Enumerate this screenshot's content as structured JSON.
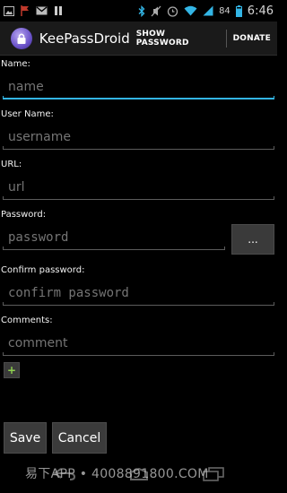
{
  "status_bar": {
    "time": "6:46",
    "battery": "84",
    "icons": [
      "image-icon",
      "flag-icon",
      "gmail-icon",
      "pause-icon",
      "bluetooth-icon",
      "mute-icon",
      "alarm-icon",
      "wifi-icon",
      "signal-icon",
      "battery-icon"
    ]
  },
  "action_bar": {
    "title": "KeePassDroid",
    "show_password": "SHOW PASSWORD",
    "donate": "DONATE"
  },
  "form": {
    "name_label": "Name:",
    "name_placeholder": "name",
    "username_label": "User Name:",
    "username_placeholder": "username",
    "url_label": "URL:",
    "url_placeholder": "url",
    "password_label": "Password:",
    "password_placeholder": "password",
    "generate_button": "...",
    "confirm_label": "Confirm password:",
    "confirm_placeholder": "confirm password",
    "comments_label": "Comments:",
    "comments_placeholder": "comment",
    "add_field": "+"
  },
  "buttons": {
    "save": "Save",
    "cancel": "Cancel"
  },
  "watermark": "易下APP • 4008891800.COM",
  "colors": {
    "focus_accent": "#33b5e5",
    "add_icon": "#8fd14f"
  }
}
